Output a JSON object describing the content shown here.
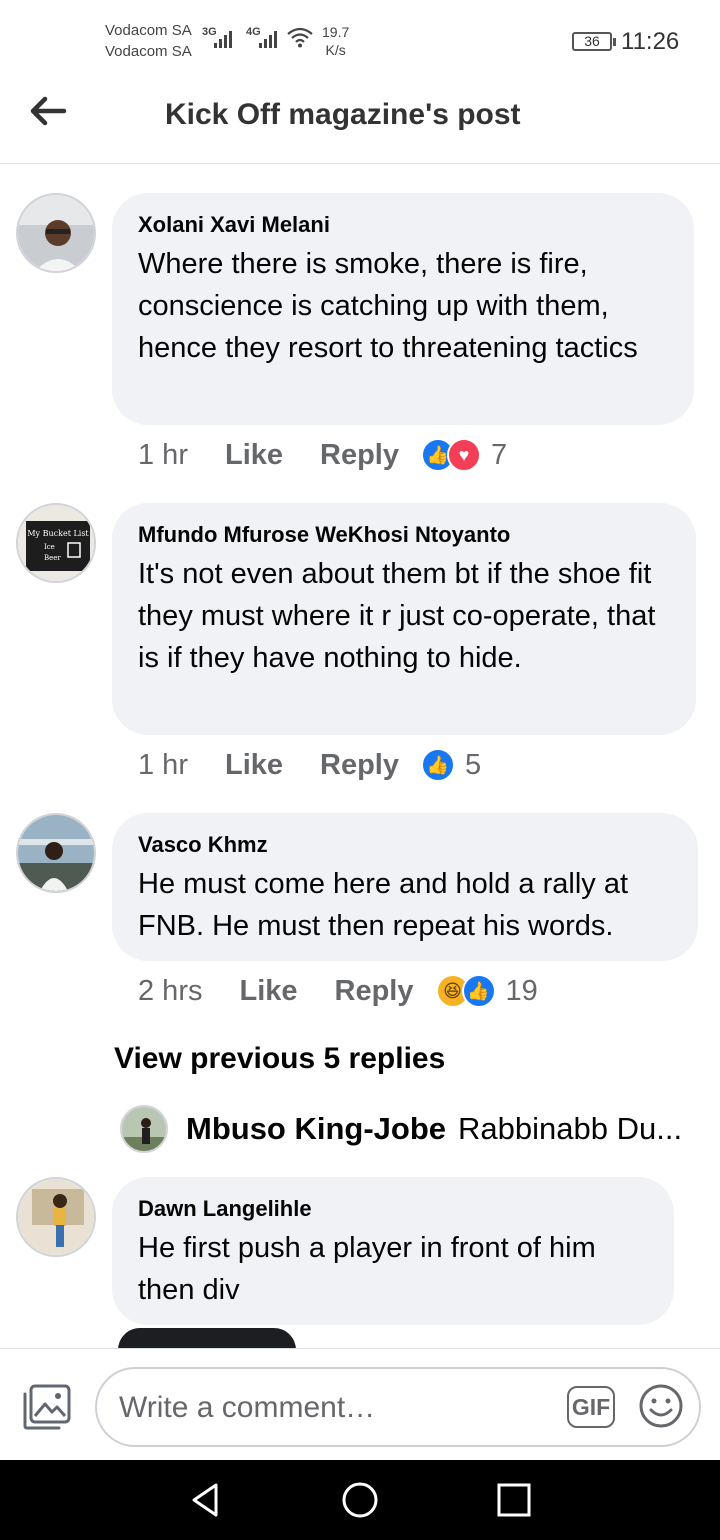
{
  "status_bar": {
    "carrier1": "Vodacom SA",
    "carrier2": "Vodacom SA",
    "net1": "3G",
    "net2": "4G",
    "speed_value": "19.7",
    "speed_unit": "K/s",
    "battery": "36",
    "time": "11:26"
  },
  "header": {
    "back_icon": "arrow-left-icon",
    "title": "Kick Off magazine's post"
  },
  "comments": [
    {
      "author": "Xolani Xavi Melani",
      "text": "Where there is smoke, there is fire, conscience  is catching up with them, hence they resort to threatening tactics",
      "time": "1 hr",
      "like": "Like",
      "reply": "Reply",
      "reactions": [
        "like",
        "love"
      ],
      "count": "7"
    },
    {
      "author": "Mfundo Mfurose WeKhosi Ntoyanto",
      "text": "It's not even about them bt if the shoe fit they must where it r just co-operate, that is if they have nothing to hide.",
      "time": "1 hr",
      "like": "Like",
      "reply": "Reply",
      "reactions": [
        "like"
      ],
      "count": "5"
    },
    {
      "author": "Vasco Khmz",
      "text": "He must come here and hold a rally at FNB. He must then repeat his words.",
      "time": "2 hrs",
      "like": "Like",
      "reply": "Reply",
      "reactions": [
        "haha",
        "like"
      ],
      "count": "19"
    },
    {
      "author": "Dawn Langelihle",
      "text": "He first push a player in front of him then div"
    }
  ],
  "replies": {
    "view_previous": "View previous 5 replies",
    "preview_author": "Mbuso King-Jobe",
    "preview_text": "Rabbinabb Du..."
  },
  "composer": {
    "placeholder": "Write a comment…",
    "gif_label": "GIF",
    "photo_icon": "photo-icon",
    "emoji_icon": "smiley-icon"
  },
  "navbar": {
    "back": "triangle-back-icon",
    "home": "circle-home-icon",
    "recents": "square-recents-icon"
  }
}
